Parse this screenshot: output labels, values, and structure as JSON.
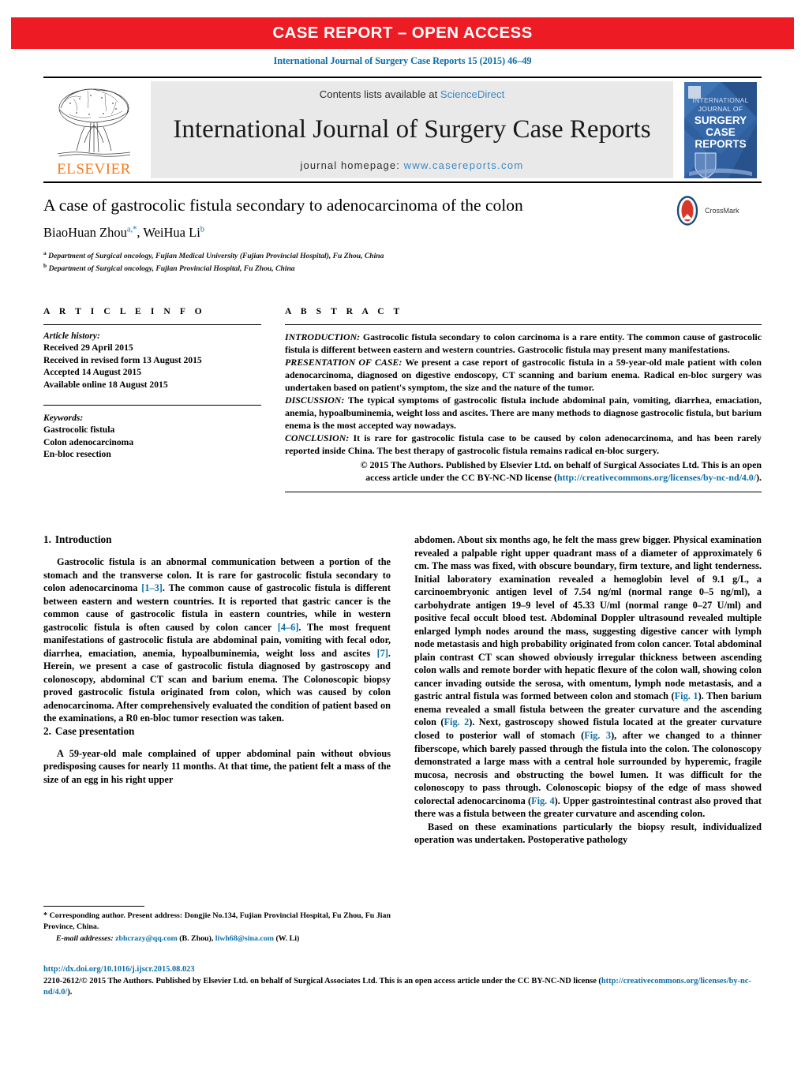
{
  "banner": {
    "text": "CASE REPORT – OPEN ACCESS"
  },
  "citation": "International Journal of Surgery Case Reports 15 (2015) 46–49",
  "masthead": {
    "publisher_name": "ELSEVIER",
    "contents_prefix": "Contents lists available at ",
    "sciencedirect": "ScienceDirect",
    "journal_title": "International Journal of Surgery Case Reports",
    "homepage_label": "journal homepage:",
    "homepage_url": "www.casereports.com",
    "cover_lines": [
      "INTERNATIONAL",
      "JOURNAL OF",
      "SURGERY",
      "CASE",
      "REPORTS"
    ]
  },
  "article": {
    "title": "A case of gastrocolic fistula secondary to adenocarcinoma of the colon",
    "crossmark_label": "CrossMark",
    "authors": [
      {
        "name": "BiaoHuan Zhou",
        "marks": "a,*"
      },
      {
        "name": "WeiHua Li",
        "marks": "b"
      }
    ],
    "affiliations": [
      {
        "mark": "a",
        "text": "Department of Surgical oncology, Fujian Medical University (Fujian Provincial Hospital), Fu Zhou, China"
      },
      {
        "mark": "b",
        "text": "Department of Surgical oncology, Fujian Provincial Hospital, Fu Zhou, China"
      }
    ]
  },
  "article_info": {
    "heading": "A R T I C L E   I N F O",
    "history_label": "Article history:",
    "history": [
      "Received 29 April 2015",
      "Received in revised form 13 August 2015",
      "Accepted 14 August 2015",
      "Available online 18 August 2015"
    ],
    "keywords_label": "Keywords:",
    "keywords": [
      "Gastrocolic fistula",
      "Colon adenocarcinoma",
      "En-bloc resection"
    ]
  },
  "abstract": {
    "heading": "A B S T R A C T",
    "sections": [
      {
        "lead": "INTRODUCTION:",
        "text": " Gastrocolic fistula secondary to colon carcinoma is a rare entity. The common cause of gastrocolic fistula is different between eastern and western countries. Gastrocolic fistula may present many manifestations."
      },
      {
        "lead": "PRESENTATION OF CASE:",
        "text": " We present a case report of gastrocolic fistula in a 59-year-old male patient with colon adenocarcinoma, diagnosed on digestive endoscopy, CT scanning and barium enema. Radical en-bloc surgery was undertaken based on patient's symptom, the size and the nature of the tumor."
      },
      {
        "lead": "DISCUSSION:",
        "text": " The typical symptoms of gastrocolic fistula include abdominal pain, vomiting, diarrhea, emaciation, anemia, hypoalbuminemia, weight loss and ascites. There are many methods to diagnose gastrocolic fistula, but barium enema is the most accepted way nowadays."
      },
      {
        "lead": "CONCLUSION:",
        "text": " It is rare for gastrocolic fistula case to be caused by colon adenocarcinoma, and has been rarely reported inside China. The best therapy of gastrocolic fistula remains radical en-bloc surgery."
      }
    ],
    "copyright_line1": "© 2015 The Authors. Published by Elsevier Ltd. on behalf of Surgical Associates Ltd. This is an open",
    "copyright_line2_pre": "access article under the CC BY-NC-ND license (",
    "copyright_link": "http://creativecommons.org/licenses/by-nc-nd/4.0/",
    "copyright_line2_post": ")."
  },
  "body": {
    "left": {
      "section1_num": "1.",
      "section1_title": "Introduction",
      "section1_para1_a": "Gastrocolic fistula is an abnormal communication between a portion of the stomach and the transverse colon. It is rare for gastrocolic fistula secondary to colon adenocarcinoma ",
      "ref1": "[1–3]",
      "section1_para1_b": ". The common cause of gastrocolic fistula is different between eastern and western countries. It is reported that gastric cancer is the common cause of gastrocolic fistula in eastern countries, while in western gastrocolic fistula is often caused by colon cancer ",
      "ref2": "[4–6]",
      "section1_para1_c": ". The most frequent manifestations of gastrocolic fistula are abdominal pain, vomiting with fecal odor, diarrhea, emaciation, anemia, hypoalbuminemia, weight loss and ascites ",
      "ref3": "[7]",
      "section1_para1_d": ". Herein, we present a case of gastrocolic fistula diagnosed by gastroscopy and colonoscopy, abdominal CT scan and barium enema. The Colonoscopic biopsy proved gastrocolic fistula originated from colon, which was caused by colon adenocarcinoma. After comprehensively evaluated the condition of patient based on the examinations, a R0 en-bloc tumor resection was taken.",
      "section2_num": "2.",
      "section2_title": "Case presentation",
      "section2_para1": "A 59-year-old male complained of upper abdominal pain without obvious predisposing causes for nearly 11 months. At that time, the patient felt a mass of the size of an egg in his right upper"
    },
    "right": {
      "para1_a": "abdomen. About six months ago, he felt the mass grew bigger. Physical examination revealed a palpable right upper quadrant mass of a diameter of approximately 6 cm. The mass was fixed, with obscure boundary, firm texture, and light tenderness. Initial laboratory examination revealed a hemoglobin level of 9.1 g/L, a carcinoembryonic antigen level of 7.54 ng/ml (normal range 0–5 ng/ml), a carbohydrate antigen 19–9 level of 45.33 U/ml (normal range 0–27 U/ml) and positive fecal occult blood test. Abdominal Doppler ultrasound revealed multiple enlarged lymph nodes around the mass, suggesting digestive cancer with lymph node metastasis and high probability originated from colon cancer. Total abdominal plain contrast CT scan showed obviously irregular thickness between ascending colon walls and remote border with hepatic flexure of the colon wall, showing colon cancer invading outside the serosa, with omentum, lymph node metastasis, and a gastric antral fistula was formed between colon and stomach (",
      "fig1": "Fig. 1",
      "para1_b": "). Then barium enema revealed a small fistula between the greater curvature and the ascending colon (",
      "fig2": "Fig. 2",
      "para1_c": "). Next, gastroscopy showed fistula located at the greater curvature closed to posterior wall of stomach (",
      "fig3": "Fig. 3",
      "para1_d": "), after we changed to a thinner fiberscope, which barely passed through the fistula into the colon. The colonoscopy demonstrated a large mass with a central hole surrounded by hyperemic, fragile mucosa, necrosis and obstructing the bowel lumen. It was difficult for the colonoscopy to pass through. Colonoscopic biopsy of the edge of mass showed colorectal adenocarcinoma (",
      "fig4": "Fig. 4",
      "para1_e": "). Upper gastrointestinal contrast also proved that there was a fistula between the greater curvature and ascending colon.",
      "para2": "Based on these examinations particularly the biopsy result, individualized operation was undertaken. Postoperative pathology"
    }
  },
  "footnotes": {
    "corresponding_star": "*",
    "corresponding_text": " Corresponding author. Present address: Dongjie No.134, Fujian Provincial Hospital, Fu Zhou, Fu Jian Province, China.",
    "email_label": "E-mail addresses:",
    "emails": [
      {
        "address": "zbhcrazy@qq.com",
        "owner": "(B. Zhou)"
      },
      {
        "address": "liwh68@sina.com",
        "owner": "(W. Li)"
      }
    ]
  },
  "footer": {
    "doi": "http://dx.doi.org/10.1016/j.ijscr.2015.08.023",
    "issn_prefix": "2210-2612/",
    "copyright": "© 2015 The Authors. Published by Elsevier Ltd. on behalf of Surgical Associates Ltd. This is an open access article under the CC BY-NC-ND license (",
    "license_link": "http://creativecommons.org/licenses/by-nc-nd/4.0/",
    "copyright_end": ")."
  },
  "colors": {
    "banner_red": "#ed1c24",
    "link_blue": "#0b6ea8",
    "sciencedirect_blue": "#3a88c4",
    "elsevier_orange": "#f47b20",
    "masthead_gray": "#e9e9e9"
  }
}
